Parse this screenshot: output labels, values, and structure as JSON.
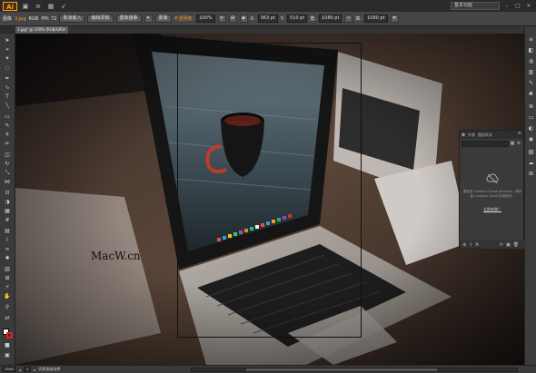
{
  "app": {
    "logo": "Ai"
  },
  "menubar": {
    "basic_label": "基本功能",
    "icons": [
      "bridge-icon",
      "stock-icon",
      "arrange-icon",
      "rocket-icon"
    ]
  },
  "controlbar": {
    "selection_label": "图像",
    "file_name": "3.jpg",
    "color_mode": "RGB",
    "ppi": "PPI: 72",
    "cancel_embed": "取消嵌入",
    "edit_original": "编辑原稿",
    "trace_preset": "图像描摹",
    "mask_label": "蒙版",
    "opacity_label": "不透明度:",
    "opacity_value": "100%",
    "x_label": "X:",
    "x_value": "363 pt",
    "y_label": "Y:",
    "y_value": "510 pt",
    "w_label": "宽:",
    "w_value": "1080 pt",
    "h_label": "高:",
    "h_value": "1080 pt"
  },
  "document_tab": {
    "title": "3.jpg* @ 100% (RGB/GPU 预览)"
  },
  "cc_panel": {
    "tabs": [
      "库",
      "外观",
      "图形样式"
    ],
    "message": "要使用 Creative Cloud Libraries，请安装 Creative Cloud 应用程序。",
    "link": "立即安装！"
  },
  "canvas": {
    "watermark": "MacW.cn"
  },
  "statusbar": {
    "zoom": "100%",
    "page": "1",
    "tool_name": "切换直接选择"
  },
  "colors": {
    "fill": "#ffffff",
    "stroke": "#e02020",
    "accent": "#f29a2e",
    "panel_bg": "#3a3a3a"
  }
}
